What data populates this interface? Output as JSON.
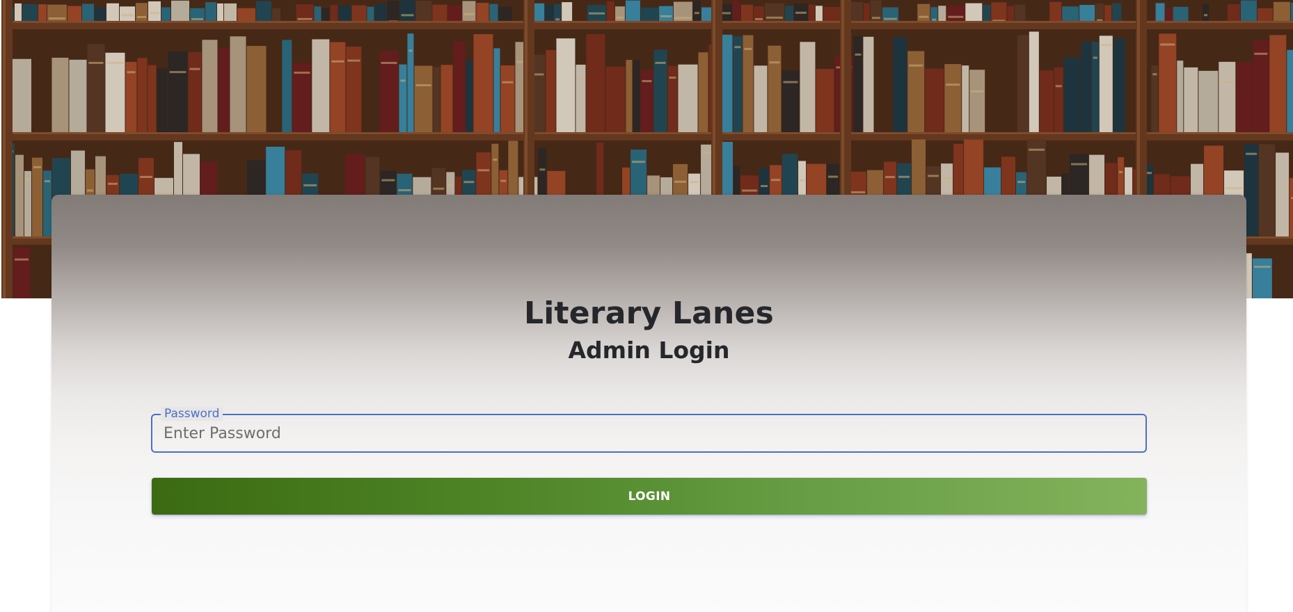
{
  "header": {
    "title": "Literary Lanes",
    "subtitle": "Admin Login"
  },
  "form": {
    "password": {
      "label": "Password",
      "placeholder": "Enter Password",
      "value": ""
    },
    "login_label": "LOGIN"
  },
  "colors": {
    "focus_accent": "#4a6fc9",
    "button_gradient_start": "#3b6a12",
    "button_gradient_end": "#84b35c",
    "heading_text": "#25272b"
  },
  "banner": {
    "image": "bookshelf-library-photo"
  }
}
